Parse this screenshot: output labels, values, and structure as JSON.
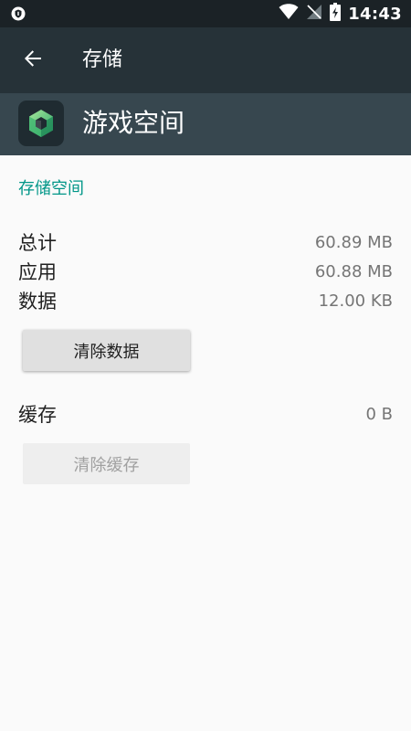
{
  "status_bar": {
    "time": "14:43",
    "icons": [
      "shield-icon",
      "wifi-icon",
      "no-sim-icon",
      "battery-charging-icon"
    ]
  },
  "toolbar": {
    "back_icon": "arrow-back-icon",
    "title": "存储"
  },
  "app": {
    "name": "游戏空间",
    "icon": "cube-app-icon"
  },
  "storage": {
    "section_title": "存储空间",
    "rows": [
      {
        "label": "总计",
        "value": "60.89 MB"
      },
      {
        "label": "应用",
        "value": "60.88 MB"
      },
      {
        "label": "数据",
        "value": "12.00 KB"
      }
    ],
    "clear_data_label": "清除数据",
    "cache_label": "缓存",
    "cache_value": "0 B",
    "clear_cache_label": "清除缓存"
  },
  "colors": {
    "status_bar": "#1b2226",
    "toolbar": "#263238",
    "app_header": "#37474f",
    "accent": "#009688",
    "background": "#fafafa"
  }
}
